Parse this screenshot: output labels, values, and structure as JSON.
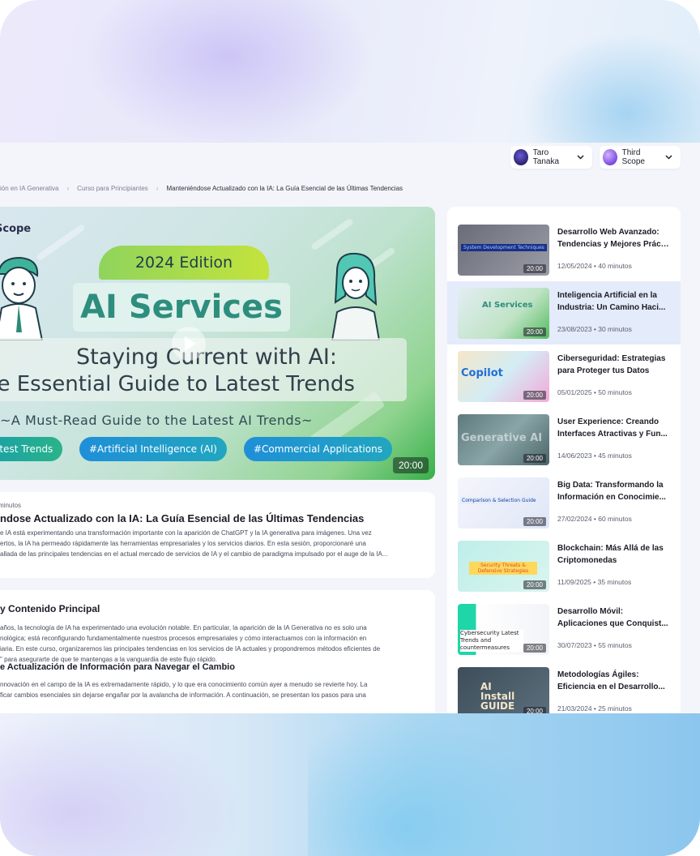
{
  "header": {
    "users": [
      {
        "name": "Taro Tanaka"
      },
      {
        "name": "Third Scope"
      }
    ]
  },
  "breadcrumb": [
    "ión en IA Generativa",
    "Curso para Principiantes",
    "Manteniéndose Actualizado con la IA: La Guía Esencial de las Últimas Tendencias"
  ],
  "video": {
    "brand": "Scope",
    "edition": "2024 Edition",
    "headline": "AI Services",
    "subtitle_line1": "Staying Current with AI:",
    "subtitle_line2": "he Essential Guide to Latest Trends",
    "tagline": "~A Must-Read Guide to the Latest AI Trends~",
    "tags": [
      "atest Trends",
      "#Artificial Intelligence (AI)",
      "#Commercial Applications"
    ],
    "duration": "20:00"
  },
  "info": {
    "meta": "minutos",
    "title": "ndose Actualizado con la IA: La Guía Esencial de las Últimas Tendencias",
    "description": [
      "e IA está experimentando una transformación importante con la aparición de ChatGPT y la IA generativa para imágenes. Una vez",
      "ertos, la IA ha permeado rápidamente las herramientas empresariales y los servicios diarios. En esta sesión, proporcionaré una",
      "allada de las principales tendencias en el actual mercado de servicios de IA y el cambio de paradigma impulsado por el auge de la IA..."
    ]
  },
  "content": {
    "heading1": "y Contenido Principal",
    "para1": [
      "años, la tecnología de IA ha experimentado una evolución notable. En particular, la aparición de la IA Generativa no es solo una",
      "nológica; está reconfigurando fundamentalmente nuestros procesos empresariales y cómo interactuamos con la información en",
      "iaria. En este curso, organizaremos las principales tendencias en los servicios de IA actuales y propondremos métodos eficientes de",
      "\" para asegurarte de que te mantengas a la vanguardia de este flujo rápido."
    ],
    "heading2": "e Actualización de Información para Navegar el Cambio",
    "para2": [
      "nnovación en el campo de la IA es extremadamente rápido, y lo que era conocimiento común ayer a menudo se revierte hoy. La",
      "ficar cambios esenciales sin dejarse engañar por la avalancha de información. A continuación, se presentan los pasos para una"
    ]
  },
  "related": [
    {
      "title1": "Desarrollo Web Avanzado:",
      "title2": "Tendencias y Mejores Prácti...",
      "meta": "12/05/2024 • 40 minutos",
      "duration": "20:00",
      "thumb_text": "System Development Techniques",
      "thumb_label": "system-development-thumbnail"
    },
    {
      "title1": "Inteligencia Artificial en la",
      "title2": "Industria: Un Camino Haci...",
      "meta": "23/08/2023 • 30 minutos",
      "duration": "20:00",
      "thumb_text": "AI Services",
      "thumb_label": "ai-services-thumbnail"
    },
    {
      "title1": "Ciberseguridad: Estrategias",
      "title2": "para Proteger tus Datos",
      "meta": "05/01/2025 • 50 minutos",
      "duration": "20:00",
      "thumb_text": "Copilot",
      "thumb_label": "copilot-thumbnail"
    },
    {
      "title1": "User Experience: Creando",
      "title2": "Interfaces Atractivas y Fun...",
      "meta": "14/06/2023 • 45 minutos",
      "duration": "20:00",
      "thumb_text": "Generative AI",
      "thumb_label": "generative-ai-thumbnail"
    },
    {
      "title1": "Big Data: Transformando la",
      "title2": "Información en Conocimie...",
      "meta": "27/02/2024 • 60 minutos",
      "duration": "20:00",
      "thumb_text": "Comparison & Selection Guide",
      "thumb_label": "mobile-framework-thumbnail"
    },
    {
      "title1": "Blockchain: Más Allá de las",
      "title2": "Criptomonedas",
      "meta": "11/09/2025 • 35 minutos",
      "duration": "20:00",
      "thumb_text": "Security Threats & Defensive Strategies",
      "thumb_label": "secure-coding-thumbnail"
    },
    {
      "title1": "Desarrollo Móvil:",
      "title2": "Aplicaciones que Conquist...",
      "meta": "30/07/2023 • 55 minutos",
      "duration": "20:00",
      "thumb_text": "Cybersecurity Latest Trends and countermeasures",
      "thumb_label": "cybersecurity-thumbnail"
    },
    {
      "title1": "Metodologías Ágiles:",
      "title2": "Eficiencia en el Desarrollo...",
      "meta": "21/03/2024 • 25 minutos",
      "duration": "20:00",
      "thumb_text": "AI Install GUIDE",
      "thumb_label": "ai-install-thumbnail"
    }
  ],
  "colors": {
    "accent": "#2e8e7e",
    "active_row": "#e4ebfa",
    "page_bg": "#f3f5fb"
  }
}
